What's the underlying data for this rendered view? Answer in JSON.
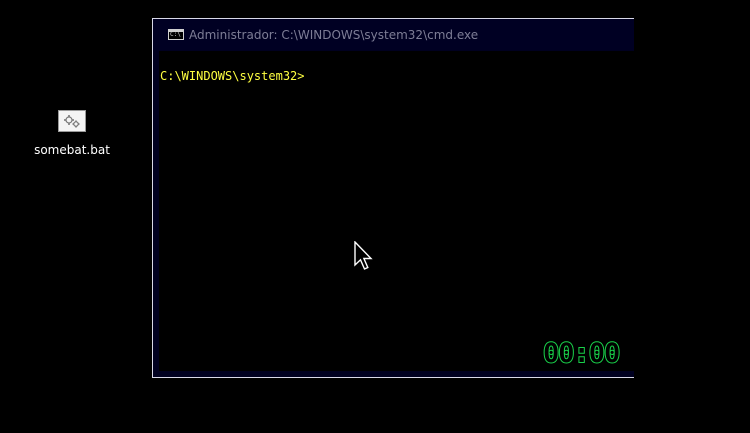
{
  "desktop": {
    "background_color": "#000000",
    "icons": [
      {
        "label": "somebat.bat",
        "icon": "batch-file-gears-icon"
      }
    ]
  },
  "window": {
    "title": "Administrador: C:\\WINDOWS\\system32\\cmd.exe",
    "app_icon": "cmd-icon",
    "app_icon_glyph": "C:\\",
    "prompt": "C:\\WINDOWS\\system32>",
    "prompt_color": "#ffff40",
    "console_background": "#000000",
    "frame_color": "#000023"
  },
  "timer": {
    "text": "00:00",
    "color": "#19d14a"
  },
  "cursor": {
    "icon": "arrow-cursor-icon"
  }
}
